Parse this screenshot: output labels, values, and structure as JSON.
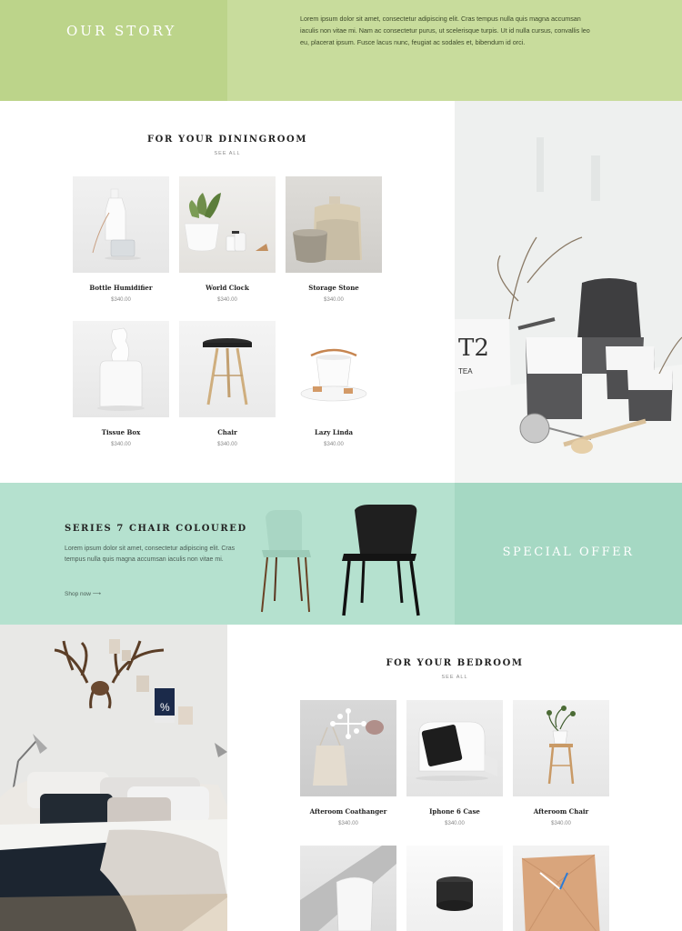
{
  "story": {
    "title": "OUR STORY",
    "text": "Lorem ipsum dolor sit amet, consectetur adipiscing elit. Cras tempus nulla quis magna accumsan iaculis non vitae mi. Nam ac consectetur purus, ut scelerisque turpis. Ut id nulla cursus, convallis leo eu, placerat ipsum. Fusce lacus nunc, feugiat ac sodales et, bibendum id orci."
  },
  "dining": {
    "title": "FOR YOUR DININGROOM",
    "see_all": "SEE ALL",
    "products": [
      {
        "name": "Bottle Humidifier",
        "price": "$340.00"
      },
      {
        "name": "World Clock",
        "price": "$340.00"
      },
      {
        "name": "Storage Stone",
        "price": "$340.00"
      },
      {
        "name": "Tissue Box",
        "price": "$340.00"
      },
      {
        "name": "Chair",
        "price": "$340.00"
      },
      {
        "name": "Lazy Linda",
        "price": "$340.00"
      }
    ]
  },
  "offer": {
    "title": "SERIES 7 CHAIR COLOURED",
    "text": "Lorem ipsum dolor sit amet, consectetur adipiscing elit. Cras tempus nulla quis magna accumsan iaculis non vitae mi.",
    "shop_now": "Shop now  ⟶",
    "special": "SPECIAL OFFER"
  },
  "bedroom": {
    "title": "FOR YOUR BEDROOM",
    "see_all": "SEE ALL",
    "products": [
      {
        "name": "Afteroom Coathanger",
        "price": "$340.00"
      },
      {
        "name": "Iphone 6 Case",
        "price": "$340.00"
      },
      {
        "name": "Afteroom Chair",
        "price": "$340.00"
      }
    ]
  },
  "colors": {
    "story_left": "#bcd48a",
    "story_right": "#c8dc9c",
    "offer_main": "#b5e1cf",
    "offer_side": "#a5d8c3"
  }
}
